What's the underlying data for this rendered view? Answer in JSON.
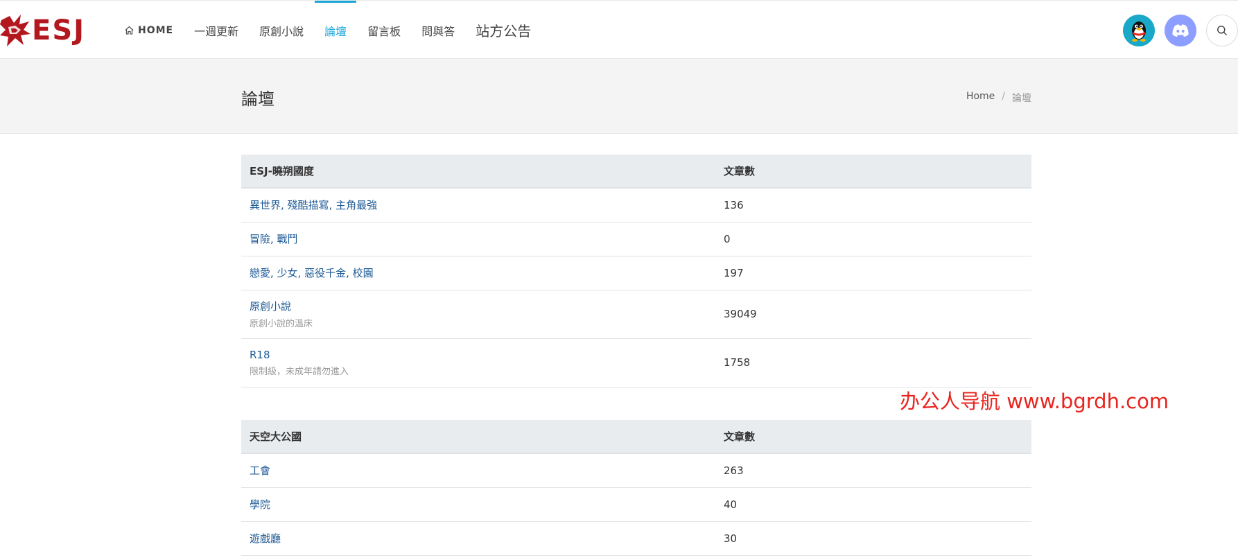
{
  "brand": {
    "logo_text": "ESJ",
    "accent_color": "#b3181f"
  },
  "nav": {
    "items": [
      {
        "label": "HOME",
        "icon": "home-icon"
      },
      {
        "label": "一週更新"
      },
      {
        "label": "原創小說"
      },
      {
        "label": "論壇",
        "active": true
      },
      {
        "label": "留言板"
      },
      {
        "label": "問與答"
      },
      {
        "label": "站方公告"
      }
    ],
    "active_color": "#1ea6d9"
  },
  "header_actions": {
    "qq": {
      "icon": "qq-penguin-icon"
    },
    "discord": {
      "icon": "discord-icon"
    },
    "search": {
      "icon": "search-icon"
    }
  },
  "page": {
    "title": "論壇",
    "breadcrumb": {
      "home": "Home",
      "separator": "/",
      "current": "論壇"
    }
  },
  "tables": [
    {
      "header_name": "ESJ-曉朔國度",
      "header_count": "文章數",
      "rows": [
        {
          "name": "異世界, 殘酷描寫, 主角最強",
          "desc": "",
          "count": "136"
        },
        {
          "name": "冒險, 戰鬥",
          "desc": "",
          "count": "0"
        },
        {
          "name": "戀愛, 少女, 惡役千金, 校園",
          "desc": "",
          "count": "197"
        },
        {
          "name": "原創小說",
          "desc": "原創小說的溫床",
          "count": "39049"
        },
        {
          "name": "R18",
          "desc": "限制級，未成年請勿進入",
          "count": "1758"
        }
      ]
    },
    {
      "header_name": "天空大公國",
      "header_count": "文章數",
      "rows": [
        {
          "name": "工會",
          "desc": "",
          "count": "263"
        },
        {
          "name": "學院",
          "desc": "",
          "count": "40"
        },
        {
          "name": "遊戲廳",
          "desc": "",
          "count": "30"
        }
      ]
    }
  ],
  "watermark": {
    "text": "办公人导航 www.bgrdh.com",
    "color": "#e8241d"
  }
}
